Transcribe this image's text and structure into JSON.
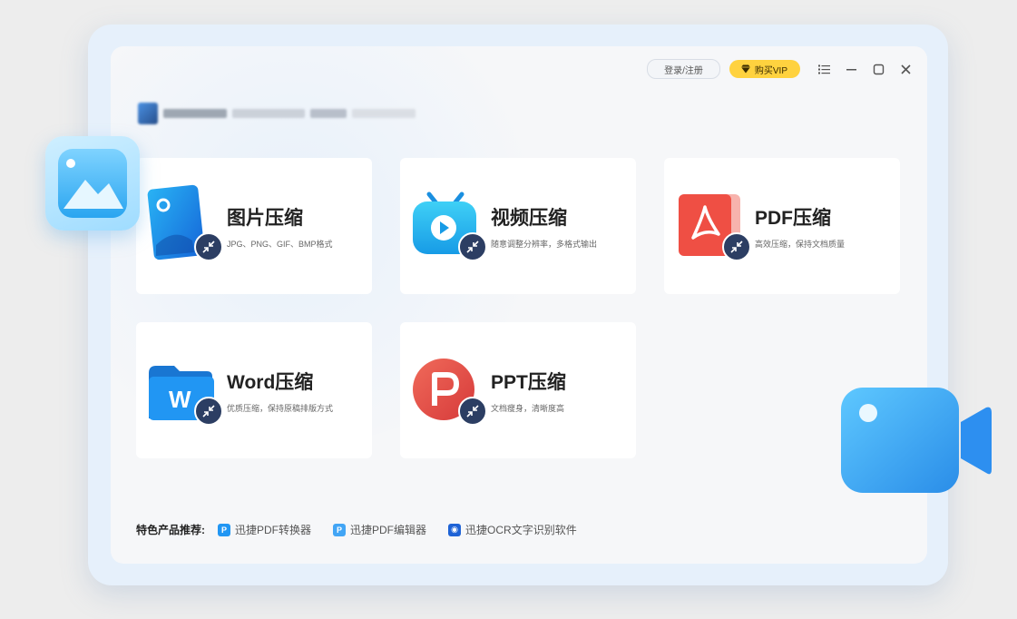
{
  "titlebar": {
    "login_label": "登录/注册",
    "vip_label": "购买VIP"
  },
  "cards": [
    {
      "title": "图片压缩",
      "subtitle": "JPG、PNG、GIF、BMP格式"
    },
    {
      "title": "视频压缩",
      "subtitle": "随意调整分辨率，多格式输出"
    },
    {
      "title": "PDF压缩",
      "subtitle": "高效压缩，保持文档质量"
    },
    {
      "title": "Word压缩",
      "subtitle": "优质压缩，保持原稿排版方式"
    },
    {
      "title": "PPT压缩",
      "subtitle": "文档瘦身，清晰度高"
    }
  ],
  "footer": {
    "label": "特色产品推荐:",
    "links": [
      {
        "label": "迅捷PDF转换器"
      },
      {
        "label": "迅捷PDF编辑器"
      },
      {
        "label": "迅捷OCR文字识别软件"
      }
    ]
  },
  "colors": {
    "vip": "#ffd23f",
    "compress_badge": "#2c3e63",
    "accent_blue": "#2196f3",
    "pdf_red": "#ef4f44",
    "ppt_red": "#e8524a"
  }
}
